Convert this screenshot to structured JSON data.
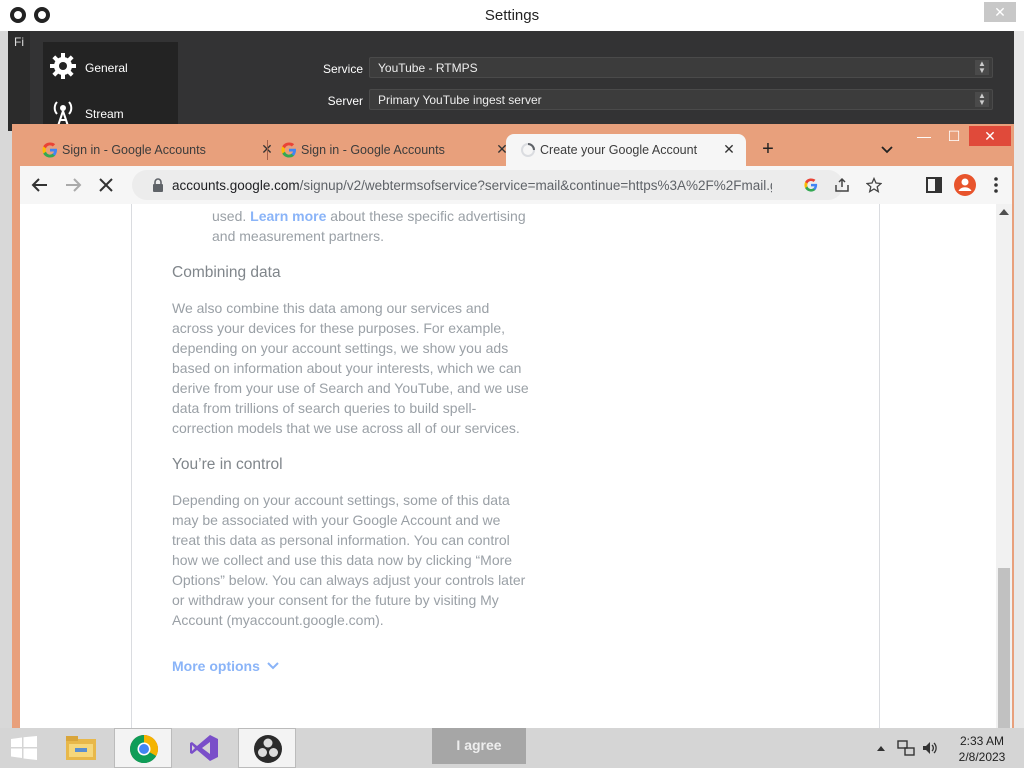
{
  "obs": {
    "title": "Settings",
    "close": "✕",
    "left_strip_text": "Fi",
    "nav": [
      {
        "label": "General",
        "icon": "gear-icon"
      },
      {
        "label": "Stream",
        "icon": "antenna-icon"
      }
    ],
    "fields": [
      {
        "label": "Service",
        "value": "YouTube - RTMPS"
      },
      {
        "label": "Server",
        "value": "Primary YouTube ingest server"
      }
    ]
  },
  "chrome": {
    "tabs": [
      {
        "title": "Sign in - Google Accounts",
        "icon": "google-g-icon",
        "active": false
      },
      {
        "title": "Sign in - Google Accounts",
        "icon": "google-g-icon",
        "active": false
      },
      {
        "title": "Create your Google Account",
        "icon": "loading-spinner-icon",
        "active": true
      }
    ],
    "new_tab": "+",
    "window_controls": {
      "minimize": "—",
      "maximize": "☐",
      "close": "✕"
    },
    "url_host": "accounts.google.com",
    "url_rest": "/signup/v2/webtermsofservice?service=mail&continue=https%3A%2F%2Fmail.g..."
  },
  "page": {
    "intro_pre": "used.",
    "intro_link": "Learn more",
    "intro_post": "about these specific advertising and measurement partners.",
    "sections": [
      {
        "heading": "Combining data",
        "body": "We also combine this data among our services and across your devices for these purposes. For example, depending on your account settings, we show you ads based on information about your interests, which we can derive from your use of Search and YouTube, and we use data from trillions of search queries to build spell-correction models that we use across all of our services."
      },
      {
        "heading": "You’re in control",
        "body": "Depending on your account settings, some of this data may be associated with your Google Account and we treat this data as personal information. You can control how we collect and use this data now by clicking “More Options” below. You can always adjust your controls later or withdraw your consent for the future by visiting My Account (myaccount.google.com)."
      }
    ],
    "more_options": "More options",
    "agree_button": "I agree"
  },
  "taskbar": {
    "items": [
      "windows-start-icon",
      "file-explorer-icon",
      "chrome-icon",
      "visual-studio-icon",
      "obs-icon"
    ],
    "time": "2:33 AM",
    "date": "2/8/2023"
  },
  "colors": {
    "chrome_frame": "#e8a07c",
    "obs_dark": "#333334",
    "link_blue": "#8ab4f8"
  }
}
